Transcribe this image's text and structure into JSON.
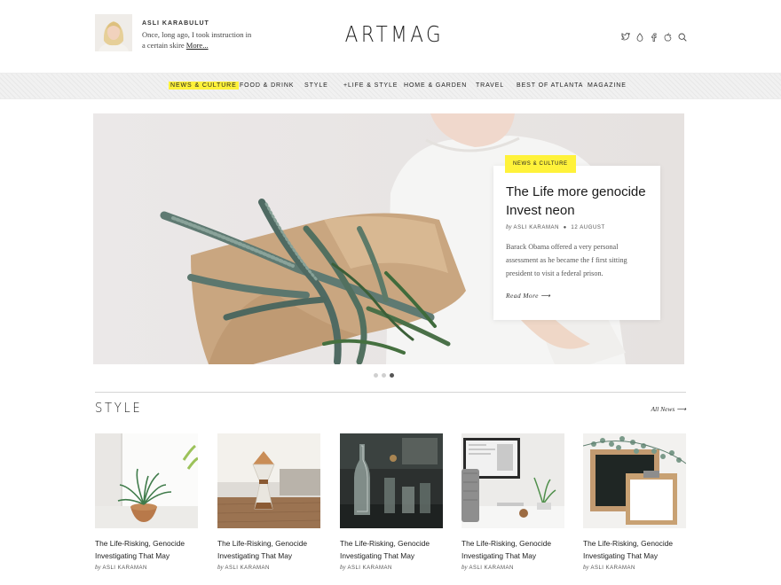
{
  "header": {
    "author_name": "ASLI KARABULUT",
    "author_bio": "Once, long ago, I took instruction in a certain skire",
    "more_label": "More...",
    "logo": "ARTMAG",
    "icons": [
      "twitter-icon",
      "drop-icon",
      "facebook-icon",
      "apple-icon",
      "search-icon"
    ]
  },
  "nav": {
    "items": [
      {
        "label": "NEWS & CULTURE",
        "active": true
      },
      {
        "label": "FOOD & DRINK"
      },
      {
        "label": "STYLE"
      },
      {
        "label": "+LIFE & STYLE"
      },
      {
        "label": "HOME & GARDEN"
      },
      {
        "label": "TRAVEL"
      },
      {
        "label": "BEST OF ATLANTA"
      },
      {
        "label": "MAGAZINE"
      }
    ]
  },
  "hero": {
    "category": "NEWS & CULTURE",
    "title": "The Life more genocide Invest neon",
    "by": "by",
    "author": "ASLI KARAMAN",
    "date": "12 AUGUST",
    "excerpt": "Barack Obama offered a very personal assessment as he became the f first sitting president to visit a federal prison.",
    "read_more": "Read More",
    "slide_count": 3,
    "active_slide": 3
  },
  "style_section": {
    "title": "STYLE",
    "all_news": "All News",
    "cards": [
      {
        "title": "The Life-Risking, Genocide Investigating That May",
        "by": "by",
        "author": "ASLI KARAMAN"
      },
      {
        "title": "The Life-Risking, Genocide Investigating That May",
        "by": "by",
        "author": "ASLI KARAMAN"
      },
      {
        "title": "The Life-Risking, Genocide Investigating That May",
        "by": "by",
        "author": "ASLI KARAMAN"
      },
      {
        "title": "The Life-Risking, Genocide Investigating That May",
        "by": "by",
        "author": "ASLI KARAMAN"
      },
      {
        "title": "The Life-Risking, Genocide Investigating That May",
        "by": "by",
        "author": "ASLI KARAMAN"
      }
    ]
  },
  "colors": {
    "accent_yellow": "#fff23a",
    "text_dark": "#222222",
    "nav_background": "#f1f1f1"
  }
}
